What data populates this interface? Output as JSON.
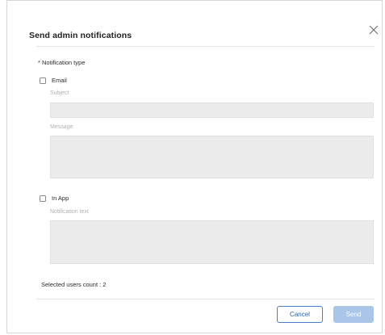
{
  "dialog": {
    "title": "Send admin notifications",
    "notification_type_label": "* Notification type",
    "email": {
      "label": "Email",
      "checked": false,
      "subject_label": "Subject",
      "subject_value": "",
      "message_label": "Message",
      "message_value": ""
    },
    "in_app": {
      "label": "In App",
      "checked": false,
      "notification_text_label": "Notification text",
      "notification_text_value": ""
    },
    "selected_users_count": "Selected users count : 2",
    "buttons": {
      "cancel_label": "Cancel",
      "send_label": "Send"
    }
  },
  "colors": {
    "accent": "#4a7fc4",
    "send_disabled": "#a9c6e8",
    "input_bg": "#ececec"
  },
  "icons": {
    "close": "close-icon"
  }
}
